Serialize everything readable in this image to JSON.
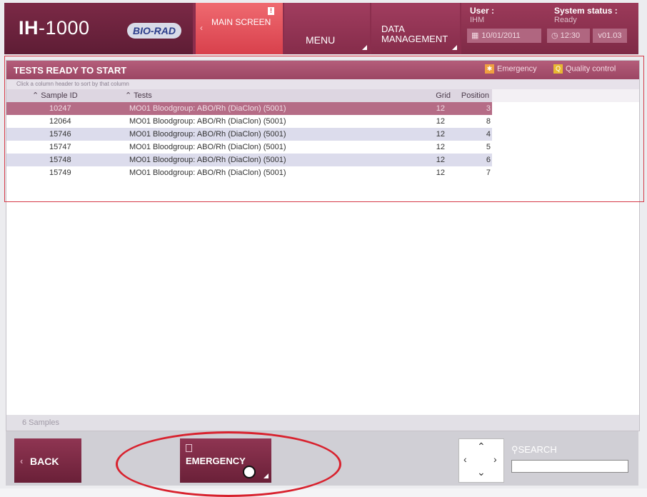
{
  "header": {
    "logo_bold": "IH",
    "logo_rest": "-1000",
    "brand": "BIO-RAD",
    "tabs": {
      "main_screen": "MAIN SCREEN",
      "main_badge": "!",
      "menu": "MENU",
      "data_management": "DATA MANAGEMENT"
    },
    "user_label": "User :",
    "user_value": "IHM",
    "system_status_label": "System status :",
    "system_status_value": "Ready",
    "date": "10/01/2011",
    "time": "12:30",
    "version": "v01.03"
  },
  "panel": {
    "title": "TESTS READY TO START",
    "legend_emergency": "Emergency",
    "legend_quality": "Quality control",
    "sort_hint": "Click a column header to sort by that column",
    "columns": {
      "sample_id": "Sample ID",
      "tests": "Tests",
      "grid": "Grid",
      "position": "Position"
    },
    "rows": [
      {
        "sample_id": "10247",
        "test": "MO01 Bloodgroup: ABO/Rh (DiaClon) (5001)",
        "grid": "12",
        "position": "3"
      },
      {
        "sample_id": "12064",
        "test": "MO01 Bloodgroup: ABO/Rh (DiaClon) (5001)",
        "grid": "12",
        "position": "8"
      },
      {
        "sample_id": "15746",
        "test": "MO01 Bloodgroup: ABO/Rh (DiaClon) (5001)",
        "grid": "12",
        "position": "4"
      },
      {
        "sample_id": "15747",
        "test": "MO01 Bloodgroup: ABO/Rh (DiaClon) (5001)",
        "grid": "12",
        "position": "5"
      },
      {
        "sample_id": "15748",
        "test": "MO01 Bloodgroup: ABO/Rh (DiaClon) (5001)",
        "grid": "12",
        "position": "6"
      },
      {
        "sample_id": "15749",
        "test": "MO01 Bloodgroup: ABO/Rh (DiaClon) (5001)",
        "grid": "12",
        "position": "7"
      }
    ],
    "footer": "6 Samples"
  },
  "bottom": {
    "back": "BACK",
    "emergency": "EMERGENCY",
    "search": "SEARCH"
  },
  "colors": {
    "brand_maroon": "#8a2e4d",
    "active_tab": "#d8404c",
    "highlight_row": "#b56c86",
    "annotation_red": "#d8222e"
  },
  "icons": [
    "chevron-left-icon",
    "calendar-icon",
    "clock-icon",
    "search-icon",
    "arrow-up-icon",
    "arrow-down-icon",
    "arrow-left-icon",
    "arrow-right-icon",
    "document-icon"
  ]
}
